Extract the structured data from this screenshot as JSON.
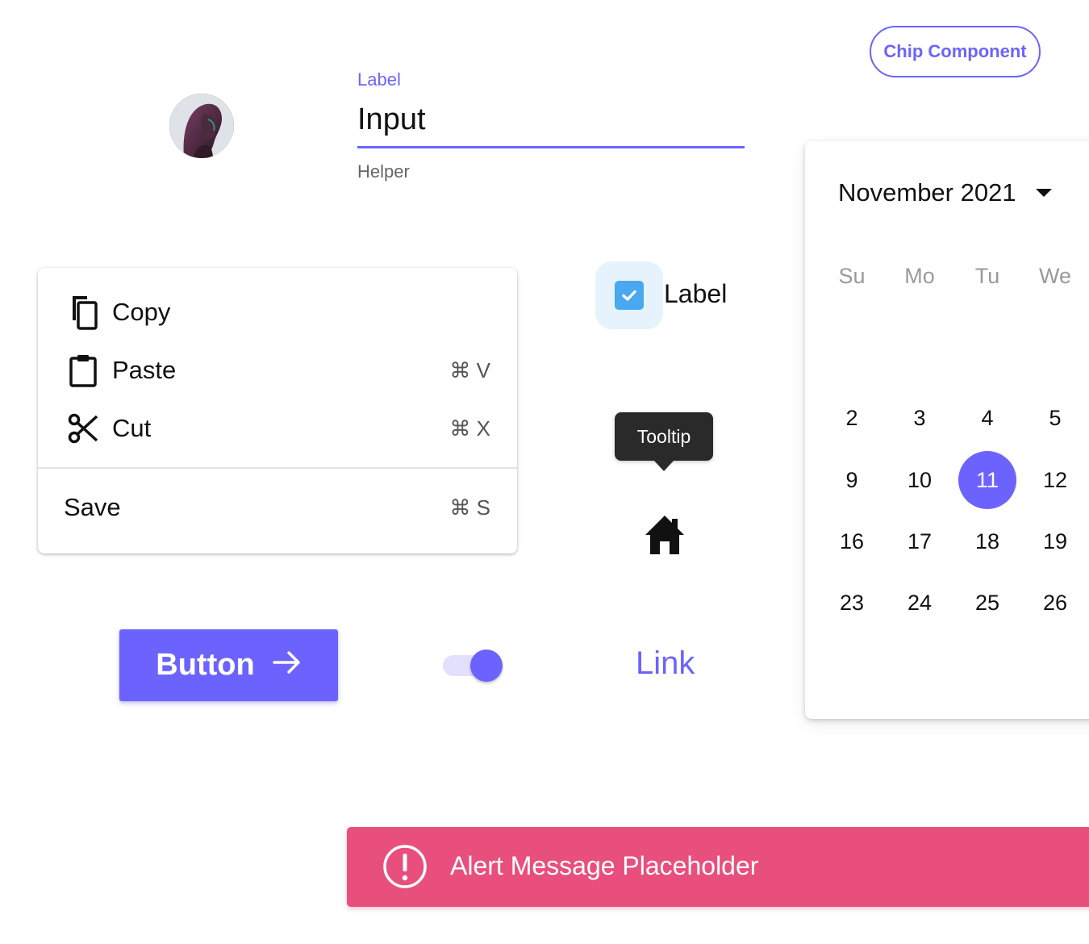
{
  "avatar": {
    "icon": "person-avatar"
  },
  "text_field": {
    "label": "Label",
    "value": "Input",
    "helper": "Helper"
  },
  "chip": {
    "label": "Chip Component"
  },
  "menu": {
    "items": [
      {
        "icon": "copy-icon",
        "label": "Copy",
        "shortcut": ""
      },
      {
        "icon": "paste-icon",
        "label": "Paste",
        "shortcut": "⌘ V"
      },
      {
        "icon": "cut-icon",
        "label": "Cut",
        "shortcut": "⌘ X"
      },
      {
        "icon": "",
        "label": "Save",
        "shortcut": "⌘ S"
      }
    ]
  },
  "checkbox": {
    "label": "Label",
    "checked": true
  },
  "tooltip": {
    "text": "Tooltip"
  },
  "button": {
    "label": "Button",
    "icon": "arrow-right-icon"
  },
  "switch": {
    "on": true
  },
  "link": {
    "label": "Link"
  },
  "calendar": {
    "month_label": "November 2021",
    "weekdays": [
      "Su",
      "Mo",
      "Tu",
      "We"
    ],
    "rows": [
      [
        "2",
        "3",
        "4",
        "5"
      ],
      [
        "9",
        "10",
        "11",
        "12"
      ],
      [
        "16",
        "17",
        "18",
        "19"
      ],
      [
        "23",
        "24",
        "25",
        "26"
      ]
    ],
    "selected": "11"
  },
  "alert": {
    "message": "Alert Message Placeholder",
    "icon": "alert-circle-icon"
  },
  "colors": {
    "primary": "#6c63ff",
    "alert": "#e94f7c",
    "checkbox": "#4aa8f0",
    "tooltip": "#2a2a2a"
  }
}
